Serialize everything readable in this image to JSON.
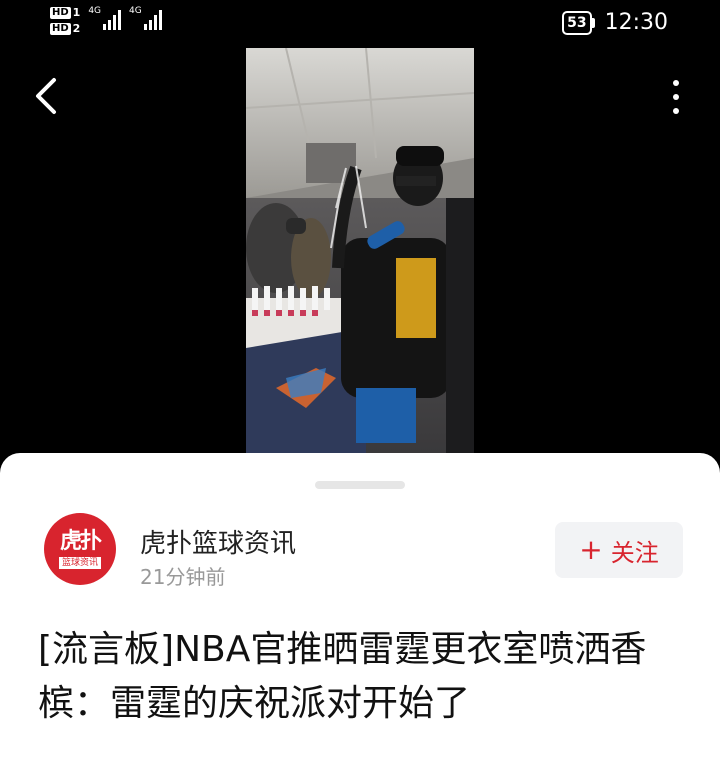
{
  "status_bar": {
    "hd1": "HD",
    "hd1_sub": "1",
    "hd2": "HD",
    "hd2_sub": "2",
    "net1": "4G",
    "net2": "4G",
    "battery": "53",
    "time": "12:30"
  },
  "nav": {
    "back_icon": "chevron-left",
    "more_icon": "vertical-ellipsis"
  },
  "author": {
    "avatar_text_top": "虎扑",
    "avatar_text_bottom": "篮球资讯",
    "name": "虎扑篮球资讯",
    "time": "21分钟前",
    "follow_icon": "+",
    "follow_label": "关注"
  },
  "post": {
    "title": "[流言板]NBA官推晒雷霆更衣室喷洒香槟：雷霆的庆祝派对开始了"
  },
  "colors": {
    "accent": "#d8242e",
    "background": "#000000"
  }
}
